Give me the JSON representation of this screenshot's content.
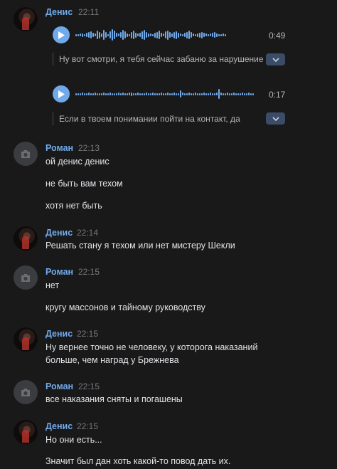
{
  "messages": [
    {
      "author": "Денис",
      "time": "22:11",
      "voice": [
        {
          "duration": "0:49",
          "transcript": "Ну вот смотри, я тебя сейчас забаню за нарушение"
        },
        {
          "duration": "0:17",
          "transcript": "Если в твоем понимании пойти на контакт, да"
        }
      ]
    },
    {
      "author": "Роман",
      "time": "22:13",
      "lines": [
        "ой денис денис",
        "не быть вам техом",
        "хотя нет быть"
      ]
    },
    {
      "author": "Денис",
      "time": "22:14",
      "lines": [
        "Решать стану я техом или нет мистеру Шекли"
      ]
    },
    {
      "author": "Роман",
      "time": "22:15",
      "lines": [
        "нет",
        "кругу массонов и тайному руководству"
      ]
    },
    {
      "author": "Денис",
      "time": "22:15",
      "lines": [
        "Ну вернее точно не человеку, у которога наказаний",
        "больше, чем наград у Брежнева"
      ]
    },
    {
      "author": "Роман",
      "time": "22:15",
      "lines": [
        "все наказания сняты и погашены"
      ]
    },
    {
      "author": "Денис",
      "time": "22:15",
      "lines": [
        "Но они есть...",
        "Значит был дан хоть какой-то повод дать их."
      ]
    }
  ],
  "icons": {
    "play": "play-icon",
    "chevron": "chevron-down-icon",
    "camera": "camera-icon"
  },
  "colors": {
    "accent": "#71aaeb",
    "background": "#19191a",
    "text": "#e1e3e6",
    "muted": "#76787a"
  }
}
